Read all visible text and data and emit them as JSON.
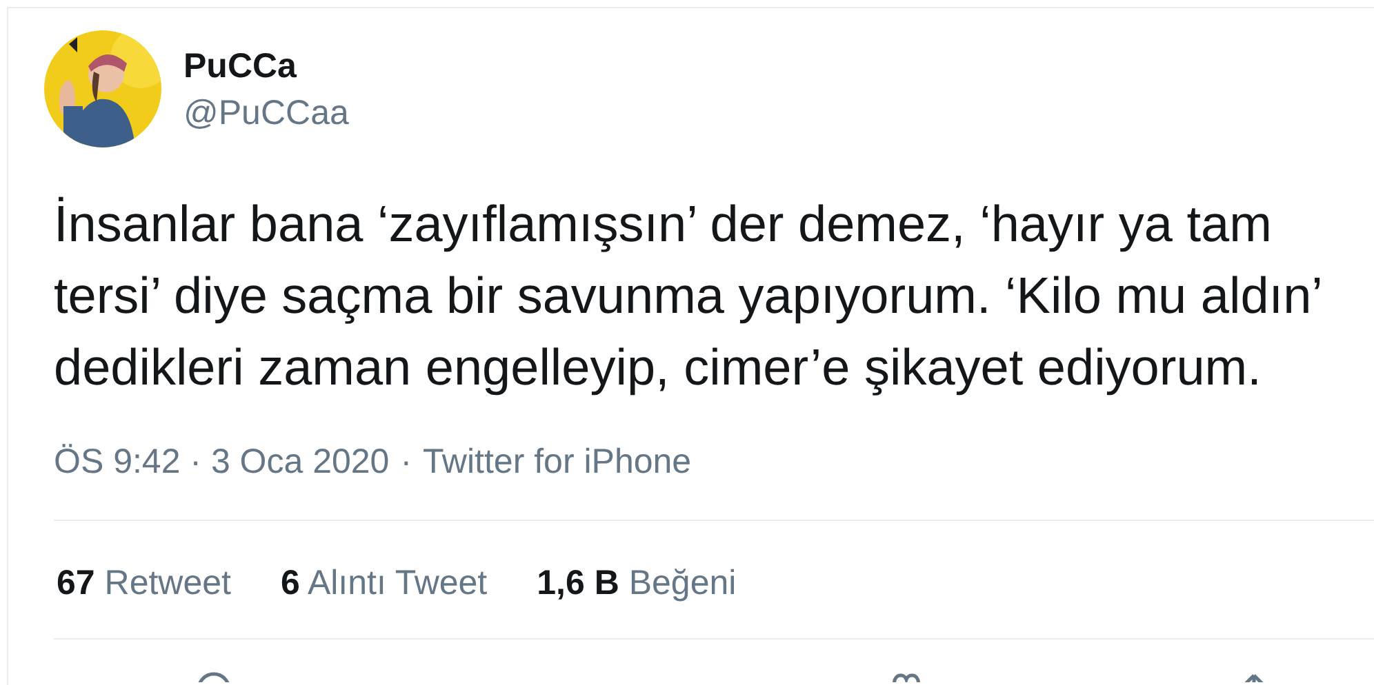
{
  "author": {
    "name": "PuCCa",
    "handle": "@PuCCaa"
  },
  "tweet": {
    "lines": [
      "İnsanlar bana ‘zayıflamışsın’ der demez, ‘hayır ya tam",
      "tersi’ diye saçma bir savunma yapıyorum. ‘Kilo mu aldın’",
      "dedikleri zaman engelleyip, cimer’e şikayet ediyorum."
    ]
  },
  "meta": {
    "timestamp": "ÖS 9:42 · 3 Oca 2020",
    "separator": "·",
    "source": "Twitter for iPhone"
  },
  "stats": [
    {
      "count": "67",
      "label": "Retweet"
    },
    {
      "count": "6",
      "label": "Alıntı Tweet"
    },
    {
      "count": "1,6 B",
      "label": "Beğeni"
    }
  ]
}
